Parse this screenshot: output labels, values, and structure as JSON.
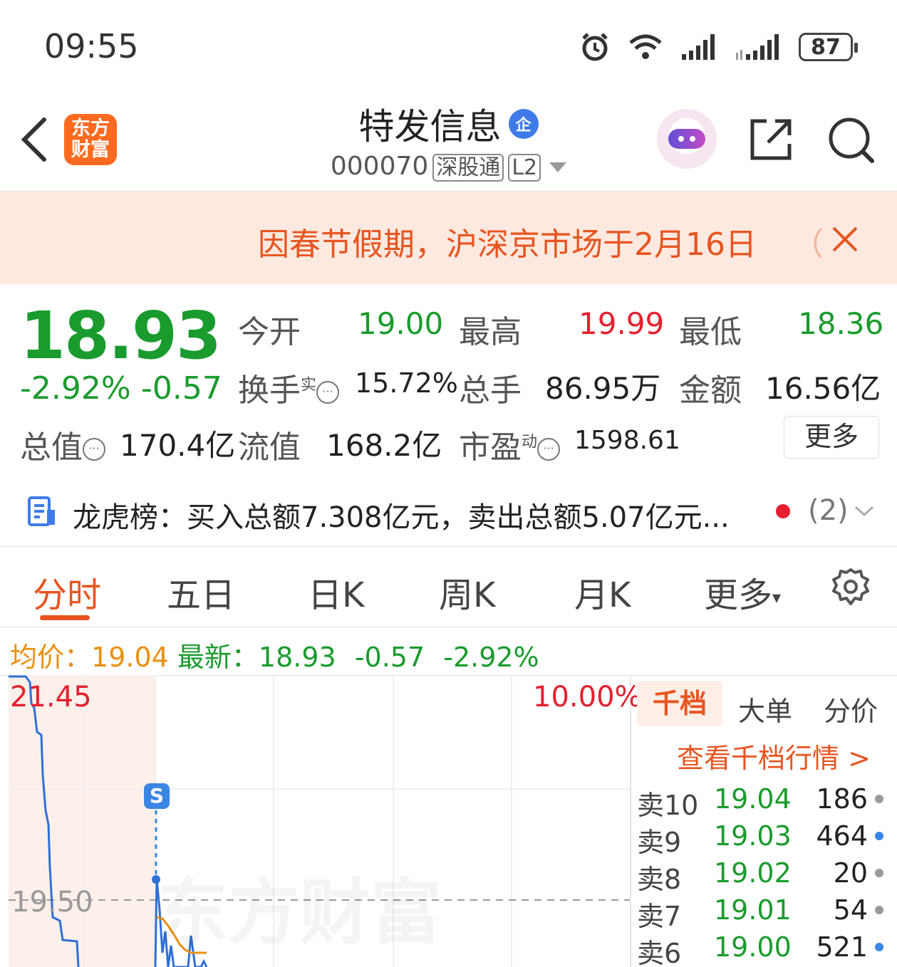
{
  "status_bar": {
    "time": "09:55",
    "battery": "87"
  },
  "header": {
    "logo_text_line1": "东方",
    "logo_text_line2": "财富",
    "stock_name": "特发信息",
    "corp_badge": "企",
    "stock_code": "000070",
    "tag_connect": "深股通",
    "tag_level": "L2"
  },
  "notice": {
    "text": "因春节假期，沪深京市场于2月16日",
    "paren": "（"
  },
  "quote": {
    "price": "18.93",
    "change_pct": "-2.92%",
    "change_abs": "-0.57",
    "open_label": "今开",
    "open": "19.00",
    "high_label": "最高",
    "high": "19.99",
    "low_label": "最低",
    "low": "18.36",
    "turnover_label": "换手",
    "turnover_sup": "实",
    "turnover": "15.72%",
    "volume_label": "总手",
    "volume": "86.95万",
    "amount_label": "金额",
    "amount": "16.56亿",
    "mktcap_label": "总值",
    "mktcap": "170.4亿",
    "float_label": "流值",
    "float_cap": "168.2亿",
    "pe_label": "市盈",
    "pe_sup": "动",
    "pe": "1598.61",
    "more_label": "更多"
  },
  "dragon_tiger": {
    "text": "龙虎榜：买入总额7.308亿元，卖出总额5.07亿元...",
    "count": "(2)"
  },
  "tabs": [
    "分时",
    "五日",
    "日K",
    "周K",
    "月K",
    "更多"
  ],
  "avg_row": {
    "avg_label": "均价：",
    "avg": "19.04",
    "latest_label": "最新：",
    "latest": "18.93",
    "change_abs": "-0.57",
    "change_pct": "-2.92%"
  },
  "chart": {
    "top_price": "21.45",
    "top_pct": "10.00%",
    "mid_price": "19.50",
    "s_badge": "S",
    "watermark": "东方财富"
  },
  "order_book": {
    "tabs": [
      "千档",
      "大单",
      "分价"
    ],
    "link": "查看千档行情 >",
    "rows": [
      {
        "name": "卖10",
        "price": "19.04",
        "volume": "186",
        "dot": "#999999"
      },
      {
        "name": "卖9",
        "price": "19.03",
        "volume": "464",
        "dot": "#3b86e3"
      },
      {
        "name": "卖8",
        "price": "19.02",
        "volume": "20",
        "dot": "#999999"
      },
      {
        "name": "卖7",
        "price": "19.01",
        "volume": "54",
        "dot": "#999999"
      },
      {
        "name": "卖6",
        "price": "19.00",
        "volume": "521",
        "dot": "#3b86e3"
      }
    ]
  },
  "colors": {
    "accent": "#e8541f",
    "down": "#1a9b2d",
    "up": "#e5202e",
    "avg": "#e9900f"
  }
}
